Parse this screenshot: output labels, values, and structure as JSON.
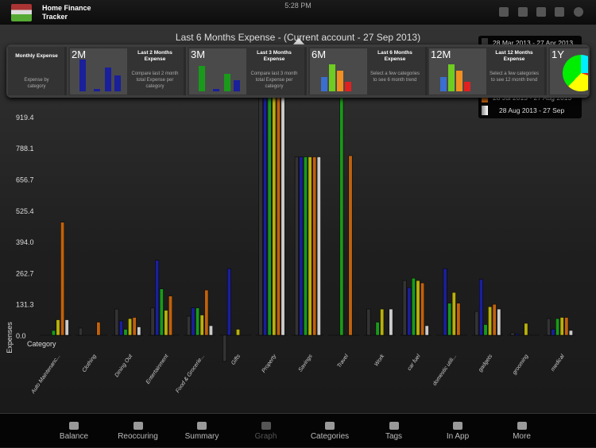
{
  "status": {
    "time": "5:28 PM"
  },
  "header": {
    "title": "Home Finance Tracker"
  },
  "chart_title": "Last 6 Months Expense - (Current account - 27 Sep 2013)",
  "legend": [
    {
      "label": "28 Mar 2013 - 27 Apr 2013",
      "color": "#333333"
    },
    {
      "label": "28 Jul 2013 - 27 Aug 2013",
      "color": "#c0620e"
    },
    {
      "label": "28 Aug 2013 - 27 Sep",
      "color": "#cccccc"
    }
  ],
  "popover": {
    "monthly": {
      "title": "Monthly Expense",
      "desc": "Expense by category"
    },
    "cards": [
      {
        "tag": "2M",
        "title": "Last 2 Months Expense",
        "desc": "Compare last 2 month total Expense per category"
      },
      {
        "tag": "3M",
        "title": "Last 3 Months Expense",
        "desc": "Compare last 3 month total Expense per category"
      },
      {
        "tag": "6M",
        "title": "Last 6 Months Expense",
        "desc": "Select a few categories to see 6 month trend"
      },
      {
        "tag": "12M",
        "title": "Last 12 Months Expense",
        "desc": "Select a few categories to see 12 month trend"
      },
      {
        "tag": "1Y"
      }
    ]
  },
  "chart_data": {
    "type": "bar",
    "ylabel": "Expenses",
    "xlabel": "Category",
    "yticks": [
      "0.0",
      "131.3",
      "262.7",
      "394.0",
      "525.4",
      "656.7",
      "788.1",
      "919.4"
    ],
    "ylim": [
      -140,
      1010
    ],
    "categories": [
      "Auto Maintenanc...",
      "Clothing",
      "Dining Out",
      "Entertainment",
      "Food & Grocerie...",
      "Gifts",
      "Property",
      "Savings",
      "Travel",
      "Work",
      "car fuel",
      "domestic utili...",
      "gadgets",
      "grooming",
      "medical"
    ],
    "series": [
      {
        "color": "#333333",
        "name": "28 Mar 2013 - 27 Apr 2013",
        "values": [
          0,
          30,
          110,
          115,
          80,
          -110,
          1050,
          750,
          0,
          110,
          230,
          0,
          100,
          10,
          70
        ]
      },
      {
        "color": "#1a1f9a",
        "values": [
          0,
          0,
          60,
          315,
          115,
          280,
          1050,
          750,
          0,
          0,
          200,
          280,
          235,
          5,
          25
        ]
      },
      {
        "color": "#1a9a1a",
        "values": [
          20,
          0,
          25,
          195,
          115,
          0,
          1050,
          750,
          1050,
          55,
          240,
          135,
          45,
          0,
          70
        ]
      },
      {
        "color": "#b8b00e",
        "values": [
          65,
          0,
          70,
          105,
          85,
          25,
          1050,
          750,
          0,
          110,
          230,
          180,
          120,
          50,
          75
        ]
      },
      {
        "color": "#c0620e",
        "name": "28 Jul 2013 - 27 Aug 2013",
        "values": [
          475,
          55,
          75,
          165,
          190,
          0,
          1050,
          750,
          755,
          0,
          220,
          135,
          130,
          0,
          75
        ]
      },
      {
        "color": "#cccccc",
        "name": "28 Aug 2013 - 27 Sep",
        "values": [
          65,
          0,
          35,
          0,
          40,
          0,
          1050,
          750,
          0,
          110,
          40,
          0,
          110,
          0,
          20
        ]
      }
    ]
  },
  "tabs": [
    {
      "label": "Balance",
      "icon": "scale-icon"
    },
    {
      "label": "Reoccuring",
      "icon": "cycle-icon"
    },
    {
      "label": "Summary",
      "icon": "piggy-bank-icon"
    },
    {
      "label": "Graph",
      "icon": "bar-chart-icon",
      "selected": true
    },
    {
      "label": "Categories",
      "icon": "folder-icon"
    },
    {
      "label": "Tags",
      "icon": "tag-icon"
    },
    {
      "label": "In App",
      "icon": "cart-icon"
    },
    {
      "label": "More",
      "icon": "more-icon"
    }
  ]
}
